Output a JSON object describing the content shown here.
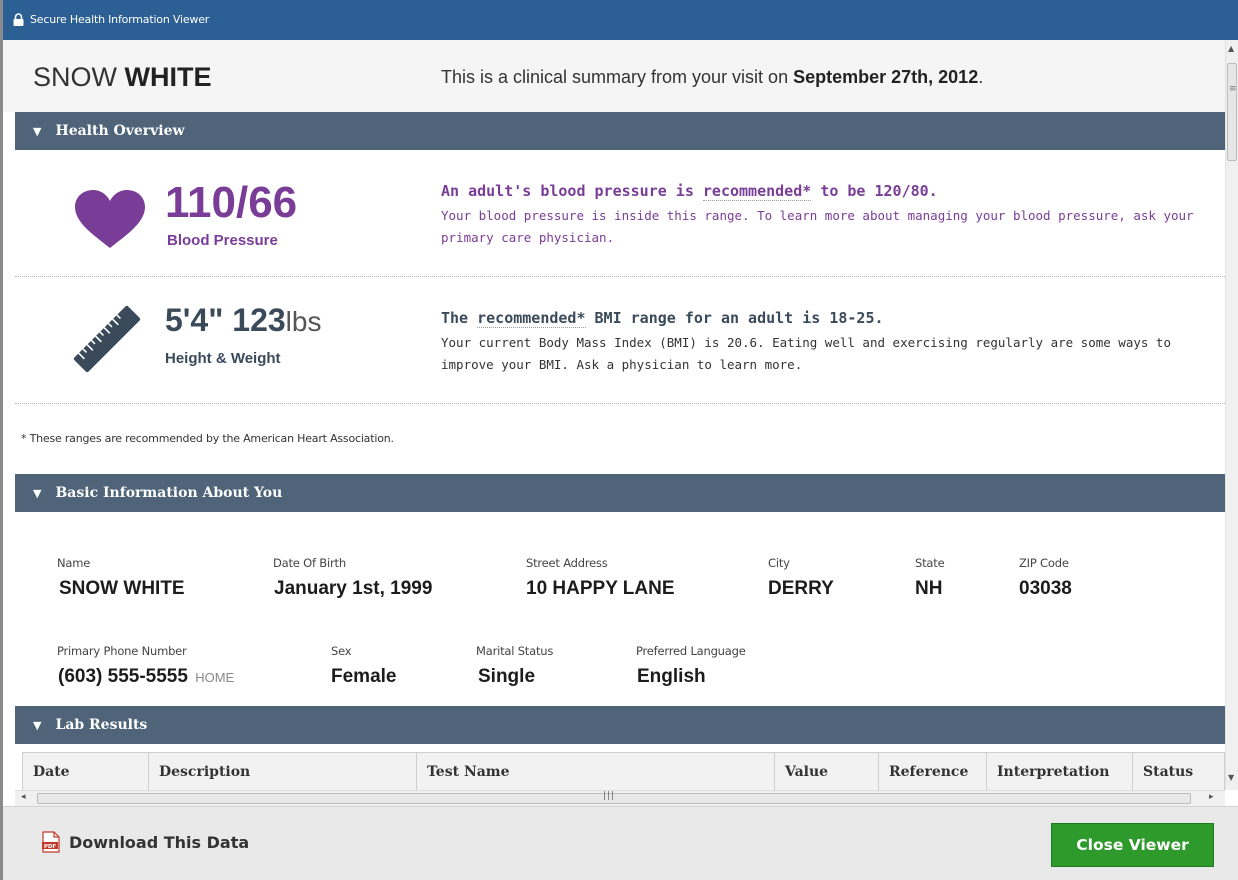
{
  "window": {
    "title": "Secure Health Information Viewer"
  },
  "header": {
    "first_name": "SNOW",
    "last_name": "WHITE",
    "summary_prefix": "This is a clinical summary from your visit on",
    "visit_date": "September 27th, 2012",
    "summary_suffix": "."
  },
  "health_overview": {
    "section_title": "Health Overview",
    "blood_pressure": {
      "value": "110/66",
      "label": "Blood Pressure",
      "rec_pre": "An adult's blood pressure is",
      "rec_link": "recommended*",
      "rec_post": "to be 120/80.",
      "detail": "Your blood pressure is inside this range. To learn more about managing your blood pressure, ask your primary care physician."
    },
    "height_weight": {
      "height": "5'4\"",
      "weight": "123",
      "weight_unit": "lbs",
      "label": "Height & Weight",
      "rec_pre": "The",
      "rec_link": "recommended*",
      "rec_post": "BMI range for an adult is 18-25.",
      "detail": "Your current Body Mass Index (BMI) is 20.6. Eating well and exercising regularly are some ways to improve your BMI. Ask a physician to learn more."
    },
    "footnote": "* These ranges are recommended by the American Heart Association."
  },
  "basic_info": {
    "section_title": "Basic Information About You",
    "name_label": "Name",
    "name": "SNOW WHITE",
    "dob_label": "Date Of Birth",
    "dob": "January 1st, 1999",
    "address_label": "Street Address",
    "address": "10 HAPPY LANE",
    "city_label": "City",
    "city": "DERRY",
    "state_label": "State",
    "state": "NH",
    "zip_label": "ZIP Code",
    "zip": "03038",
    "phone_label": "Primary Phone Number",
    "phone": "(603) 555-5555",
    "phone_type": "HOME",
    "sex_label": "Sex",
    "sex": "Female",
    "marital_label": "Marital Status",
    "marital": "Single",
    "language_label": "Preferred Language",
    "language": "English"
  },
  "lab_results": {
    "section_title": "Lab Results",
    "columns": [
      "Date",
      "Description",
      "Test Name",
      "Value",
      "Reference",
      "Interpretation",
      "Status"
    ]
  },
  "footer": {
    "download_label": "Download This Data",
    "close_label": "Close Viewer"
  },
  "colors": {
    "titlebar": "#2c5f93",
    "section": "#4f6479",
    "purple": "#7a3d97",
    "dark": "#3b4a5a",
    "close_button": "#2f9a2c"
  },
  "icons": {
    "lock": "lock-icon",
    "heart": "heart-icon",
    "ruler": "ruler-icon",
    "pdf": "pdf-icon"
  }
}
